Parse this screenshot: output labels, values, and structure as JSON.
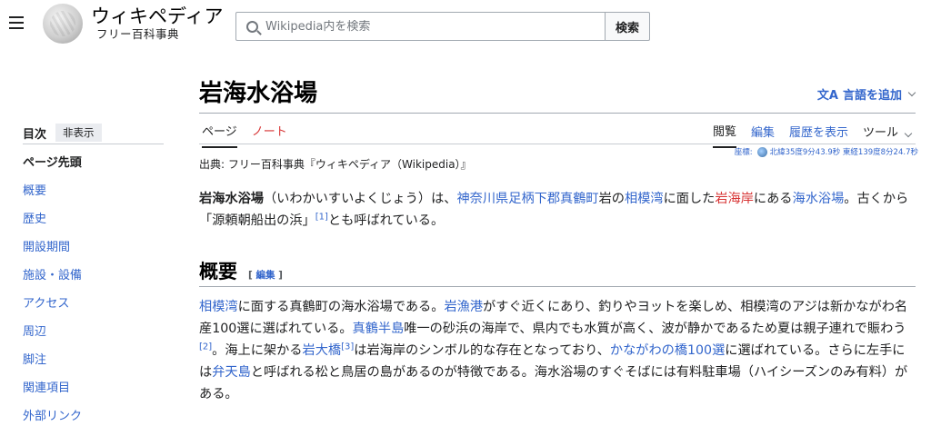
{
  "header": {
    "wordmark_main": "ウィキペディア",
    "wordmark_sub": "フリー百科事典",
    "search_placeholder": "Wikipedia内を検索",
    "search_button": "検索"
  },
  "toc": {
    "title": "目次",
    "hide": "非表示",
    "items": [
      "ページ先頭",
      "概要",
      "歴史",
      "開設期間",
      "施設・設備",
      "アクセス",
      "周辺",
      "脚注",
      "関連項目",
      "外部リンク"
    ]
  },
  "article": {
    "title": "岩海水浴場",
    "lang_icon": "文A",
    "lang_label": "言語を追加",
    "tabs_left": [
      "ページ",
      "ノート"
    ],
    "tabs_right": [
      "閲覧",
      "編集",
      "履歴を表示",
      "ツール"
    ],
    "coords_label": "座標:",
    "coords_value": "北緯35度9分43.9秒 東経139度8分24.7秒",
    "source": "出典: フリー百科事典『ウィキペディア（Wikipedia）』",
    "intro": {
      "bold": "岩海水浴場",
      "t1": "（いわかいすいよくじょう）は、",
      "link1": "神奈川県",
      "link2": "足柄下郡",
      "link3": "真鶴町",
      "t2": "岩",
      "t3": "の",
      "link4": "相模湾",
      "t4": "に面した",
      "red1": "岩海岸",
      "t5": "にある",
      "link5": "海水浴場",
      "t6": "。古くから「源頼朝船出の浜」",
      "ref1": "[1]",
      "t7": "とも呼ばれている。"
    },
    "section": {
      "heading": "概要",
      "edit": "[ 編集 ]",
      "s_link1": "相模湾",
      "s_t1": "に面する真鶴町の海水浴場である。",
      "s_link2": "岩漁港",
      "s_t2": "がすぐ近くにあり、釣りやヨットを楽しめ、相模湾のアジは新かながわ名産100選に選ばれている。",
      "s_link3": "真鶴半島",
      "s_t3": "唯一の砂浜の海岸で、県内でも水質が高く、波が静かであるため夏は親子連れで賑わう",
      "ref2": "[2]",
      "s_t4": "。海上に架かる",
      "s_link4": "岩大橋",
      "ref3": "[3]",
      "s_t5": "は岩海岸のシンボル的な存在となっており、",
      "s_link5": "かながわの橋100選",
      "s_t6": "に選ばれている。さらに左手には",
      "s_link6": "弁天島",
      "s_t7": "と呼ばれる松と鳥居の島があるのが特徴である。海水浴場のすぐそばには有料駐車場（ハイシーズンのみ有料）がある。"
    }
  }
}
